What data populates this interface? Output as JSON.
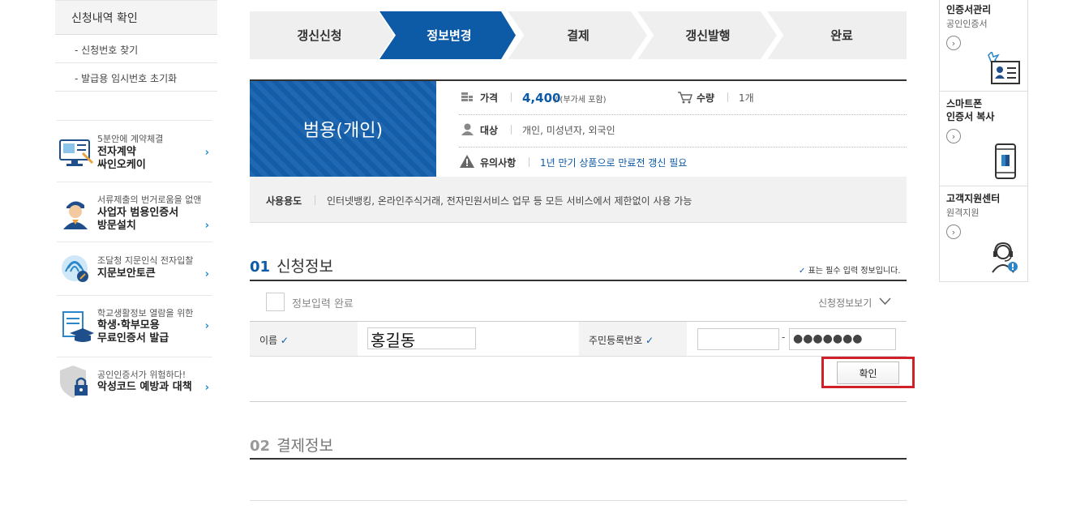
{
  "sidebar": {
    "header": "신청내역 확인",
    "sub_items": [
      "- 신청번호 찾기",
      "- 발급용 임시번호 초기화"
    ]
  },
  "promos": [
    {
      "small": "5분안에 계약체결",
      "big1": "전자계약",
      "big2": "싸인오케이",
      "icon": "e-contract-icon"
    },
    {
      "small": "서류제출의 번거로움을 없앤",
      "big1": "사업자 범용인증서",
      "big2": "방문설치",
      "icon": "visit-install-icon"
    },
    {
      "small": "조달청 지문인식 전자입찰",
      "big1": "지문보안토큰",
      "big2": "",
      "icon": "fingerprint-icon"
    },
    {
      "small": "학교생활정보 열람을 위한",
      "big1": "학생·학부모용",
      "big2": "무료인증서  발급",
      "icon": "graduation-icon"
    },
    {
      "small": "공인인증서가 위험하다!",
      "big1": "악성코드 예방과 대책",
      "big2": "",
      "icon": "shield-lock-icon"
    }
  ],
  "steps": [
    "갱신신청",
    "정보변경",
    "결제",
    "갱신발행",
    "완료"
  ],
  "product": {
    "name": "범용(개인)",
    "price_label": "가격",
    "price_value": "4,400",
    "price_note": "/ (부가세 포함)",
    "qty_label": "수량",
    "qty_value": "1개",
    "target_label": "대상",
    "target_value": "개인, 미성년자, 외국인",
    "notice_label": "유의사항",
    "notice_value": "1년 만기 상품으로 만료전 갱신 필요",
    "usage_label": "사용용도",
    "usage_value": "인터넷뱅킹, 온라인주식거래, 전자민원서비스 업무 등 모든 서비스에서 제한없이 사용 가능"
  },
  "section1": {
    "num": "01",
    "title": "신청정보",
    "required_note": "표는 필수 입력 정보입니다.",
    "complete_label": "정보입력 완료",
    "view_label": "신청정보보기",
    "name_label": "이름",
    "name_value": "홍길동",
    "rrn_label": "주민등록번호",
    "rrn_front": "",
    "rrn_dash": "-",
    "rrn_back": "●●●●●●●",
    "confirm_label": "확인"
  },
  "section2": {
    "num": "02",
    "title": "결제정보"
  },
  "right_panel": [
    {
      "title": "인증서관리",
      "sub": "공인인증서",
      "icon": "id-card-icon"
    },
    {
      "title1": "스마트폰",
      "title2": "인증서 복사",
      "icon": "smartphone-icon"
    },
    {
      "title": "고객지원센터",
      "sub": "원격지원",
      "icon": "headset-support-icon"
    }
  ],
  "colors": {
    "brand_blue": "#0d5aa7",
    "highlight_red": "#d0202a",
    "chevron_blue": "#1a8fd0"
  }
}
